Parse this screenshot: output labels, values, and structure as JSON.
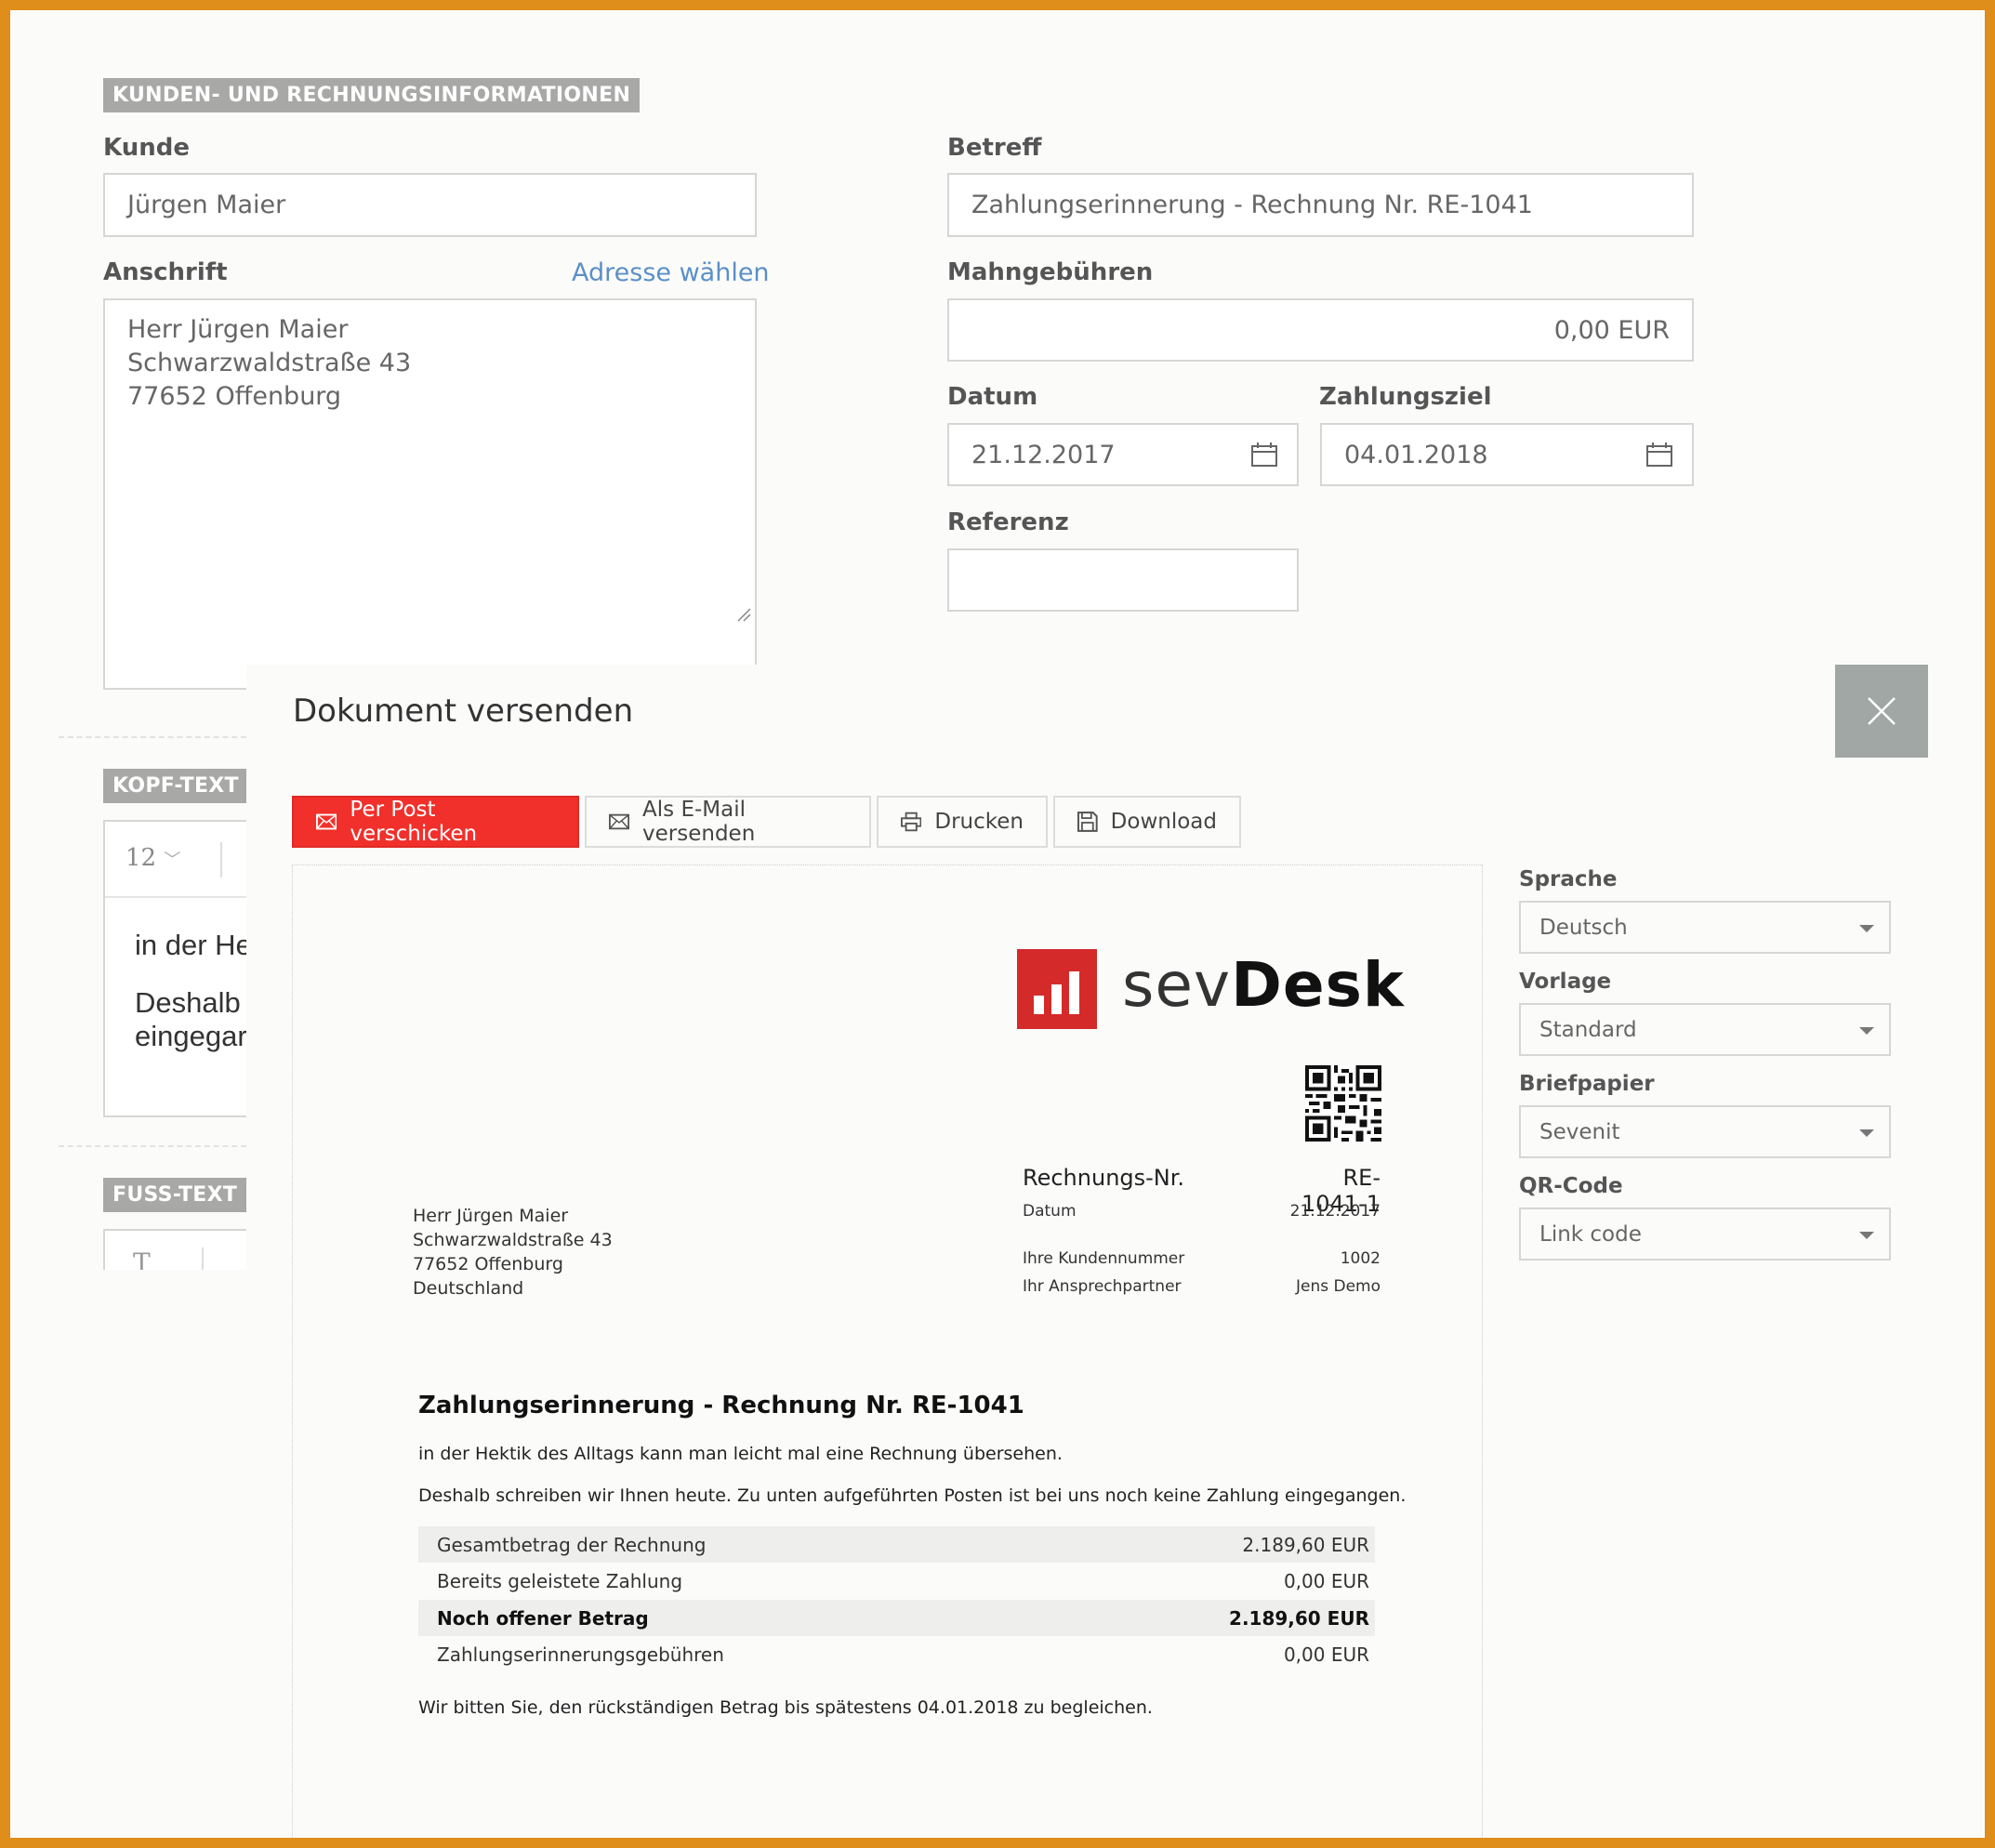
{
  "form": {
    "section_title": "KUNDEN- UND RECHNUNGSINFORMATIONEN",
    "customer_label": "Kunde",
    "customer_value": "Jürgen Maier",
    "address_label": "Anschrift",
    "address_link": "Adresse wählen",
    "address_lines": [
      "Herr Jürgen Maier",
      "Schwarzwaldstraße 43",
      "77652 Offenburg"
    ],
    "subject_label": "Betreff",
    "subject_value": "Zahlungserinnerung - Rechnung Nr. RE-1041",
    "fees_label": "Mahngebühren",
    "fees_value": "0,00 EUR",
    "date_label": "Datum",
    "date_value": "21.12.2017",
    "due_label": "Zahlungsziel",
    "due_value": "04.01.2018",
    "reference_label": "Referenz",
    "reference_value": ""
  },
  "background": {
    "header_text_tag": "KOPF-TEXT",
    "footer_text_tag": "FUSS-TEXT",
    "font_size_value": "12",
    "editor_line1": "in der He",
    "editor_line2": "Deshalb",
    "editor_line3": "eingegar",
    "footer_editor_glyph": "T"
  },
  "modal": {
    "title": "Dokument versenden",
    "tabs": [
      {
        "label": "Per Post verschicken",
        "icon": "mail-icon",
        "active": true
      },
      {
        "label": "Als E-Mail versenden",
        "icon": "mail-icon",
        "active": false
      },
      {
        "label": "Drucken",
        "icon": "printer-icon",
        "active": false
      },
      {
        "label": "Download",
        "icon": "save-icon",
        "active": false
      }
    ],
    "settings": {
      "language_label": "Sprache",
      "language_value": "Deutsch",
      "template_label": "Vorlage",
      "template_value": "Standard",
      "letterhead_label": "Briefpapier",
      "letterhead_value": "Sevenit",
      "qr_label": "QR-Code",
      "qr_value": "Link code"
    }
  },
  "document": {
    "logo_text_light": "sev",
    "logo_text_bold": "Desk",
    "invoice_no_label": "Rechnungs-Nr.",
    "invoice_no_value": "RE-1041-1",
    "date_label": "Datum",
    "date_value": "21.12.2017",
    "customer_no_label": "Ihre Kundennummer",
    "customer_no_value": "1002",
    "contact_label": "Ihr Ansprechpartner",
    "contact_value": "Jens Demo",
    "recipient_lines": [
      "Herr Jürgen Maier",
      "Schwarzwaldstraße 43",
      "77652 Offenburg",
      "Deutschland"
    ],
    "heading": "Zahlungserinnerung - Rechnung Nr. RE-1041",
    "intro1": "in der Hektik des Alltags kann man leicht mal eine Rechnung übersehen.",
    "intro2": "Deshalb schreiben wir Ihnen heute. Zu unten aufgeführten Posten ist bei uns noch keine Zahlung eingegangen.",
    "summary": [
      {
        "label": "Gesamtbetrag der Rechnung",
        "value": "2.189,60 EUR"
      },
      {
        "label": "Bereits geleistete Zahlung",
        "value": "0,00 EUR"
      },
      {
        "label": "Noch offener Betrag",
        "value": "2.189,60 EUR"
      },
      {
        "label": "Zahlungserinnerungsgebühren",
        "value": "0,00 EUR"
      }
    ],
    "closing": "Wir bitten Sie, den rückständigen Betrag bis spätestens 04.01.2018 zu begleichen."
  },
  "colors": {
    "frame": "#e08e1b",
    "accent_red": "#f1302b",
    "logo_red": "#d42a2a",
    "link_blue": "#5b8fc7",
    "tag_gray": "#a8a9a7"
  }
}
